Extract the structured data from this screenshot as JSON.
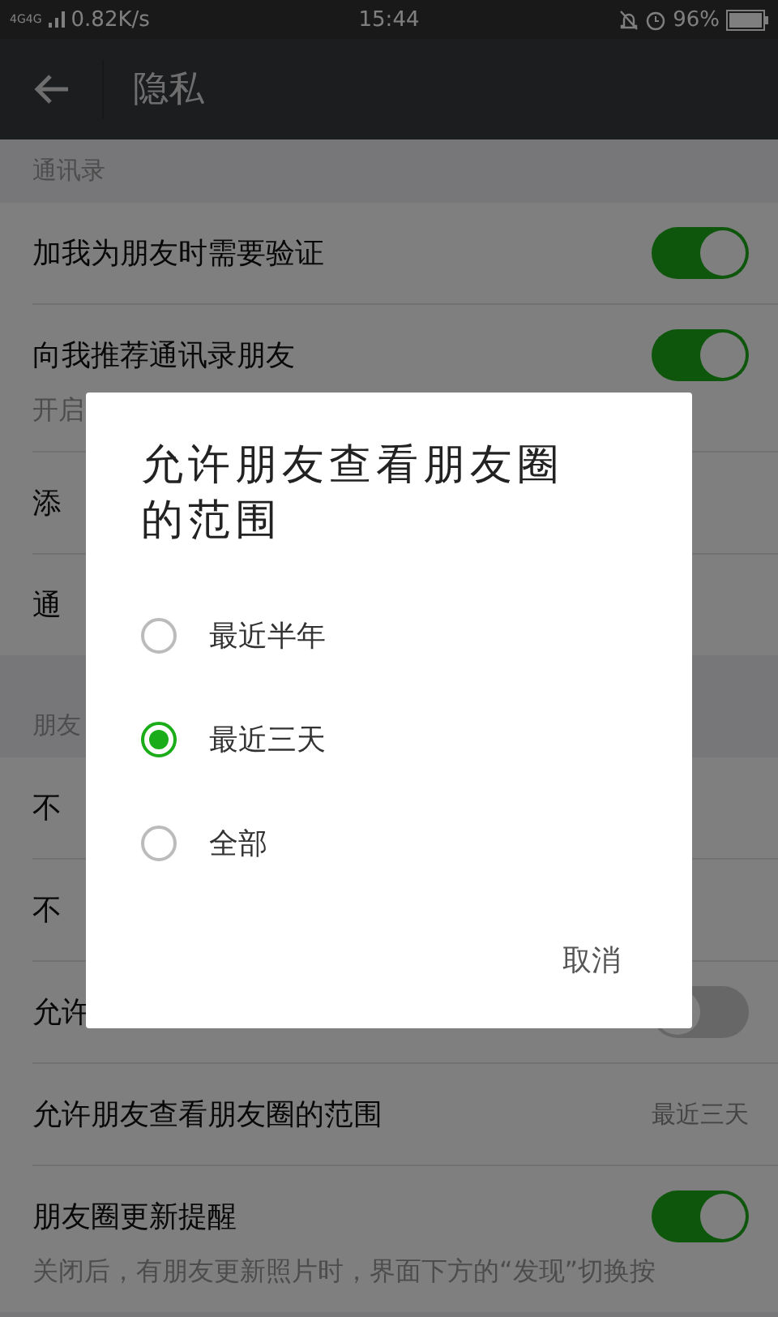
{
  "status_bar": {
    "network": "4G4G",
    "speed": "0.82K/s",
    "time": "15:44",
    "battery": "96%"
  },
  "header": {
    "title": "隐私"
  },
  "sections": [
    {
      "title": "通讯录",
      "rows": [
        {
          "label": "加我为朋友时需要验证",
          "kind": "toggle",
          "on": true
        },
        {
          "label": "向我推荐通讯录朋友",
          "kind": "toggle",
          "on": true,
          "note": "开启"
        },
        {
          "label": "添",
          "kind": "plain"
        },
        {
          "label": "通",
          "kind": "plain"
        }
      ]
    },
    {
      "title": "朋友",
      "rows": [
        {
          "label": "不",
          "kind": "plain"
        },
        {
          "label": "不",
          "kind": "plain"
        },
        {
          "label": "允许",
          "kind": "toggle",
          "on": false
        },
        {
          "label": "允许朋友查看朋友圈的范围",
          "kind": "value",
          "value": "最近三天"
        },
        {
          "label": "朋友圈更新提醒",
          "kind": "toggle",
          "on": true,
          "note": "关闭后，有朋友更新照片时，界面下方的“发现”切换按"
        }
      ]
    }
  ],
  "dialog": {
    "title": "允许朋友查看朋友圈的范围",
    "options": [
      {
        "label": "最近半年",
        "selected": false
      },
      {
        "label": "最近三天",
        "selected": true
      },
      {
        "label": "全部",
        "selected": false
      }
    ],
    "cancel": "取消"
  }
}
